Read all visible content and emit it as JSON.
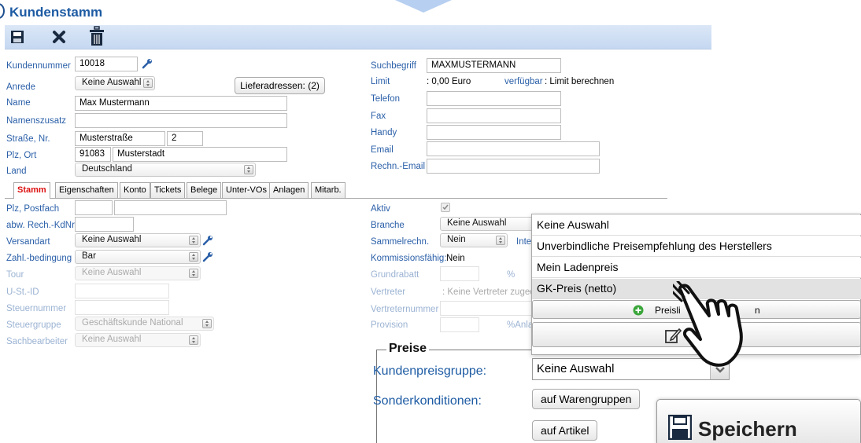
{
  "header": {
    "title": "Kundenstamm"
  },
  "toolbar": {
    "save_icon": "save-icon",
    "close_icon": "close-icon",
    "delete_icon": "trash-icon"
  },
  "left": {
    "kundennummer": {
      "label": "Kundennummer",
      "value": "10018"
    },
    "anrede": {
      "label": "Anrede",
      "value": "Keine Auswahl"
    },
    "lieferadressen_button": "Lieferadressen: (2)",
    "name": {
      "label": "Name",
      "value": "Max Mustermann"
    },
    "namenszusatz": {
      "label": "Namenszusatz",
      "value": ""
    },
    "strasse": {
      "label": "Straße, Nr.",
      "street": "Musterstraße",
      "number": "2"
    },
    "plz_ort": {
      "label": "Plz, Ort",
      "plz": "91083",
      "ort": "Musterstadt"
    },
    "land": {
      "label": "Land",
      "value": "Deutschland"
    }
  },
  "right": {
    "suchbegriff": {
      "label": "Suchbegriff",
      "value": "MAXMUSTERMANN"
    },
    "limit": {
      "label": "Limit",
      "value": ": 0,00 Euro",
      "link": "verfügbar",
      "rest": ": Limit berechnen"
    },
    "telefon": {
      "label": "Telefon",
      "value": ""
    },
    "fax": {
      "label": "Fax",
      "value": ""
    },
    "handy": {
      "label": "Handy",
      "value": ""
    },
    "email": {
      "label": "Email",
      "value": ""
    },
    "rechn_email": {
      "label": "Rechn.-Email",
      "value": ""
    }
  },
  "tabs": [
    "Stamm",
    "Eigenschaften",
    "Konto",
    "Tickets",
    "Belege",
    "Unter-VOs",
    "Anlagen",
    "Mitarb."
  ],
  "stamm_left": {
    "plz_postfach": "Plz, Postfach",
    "abw_rech": "abw. Rech.-KdNr",
    "versandart": {
      "label": "Versandart",
      "value": "Keine Auswahl"
    },
    "zahlbedingung": {
      "label": "Zahl.-bedingung",
      "value": "Bar"
    },
    "tour": {
      "label": "Tour",
      "value": "Keine Auswahl"
    },
    "ust_id": "U-St.-ID",
    "steuernummer": "Steuernummer",
    "steuergruppe": {
      "label": "Steuergruppe",
      "value": "Geschäftskunde National"
    },
    "sachbearbeiter": {
      "label": "Sachbearbeiter",
      "value": "Keine Auswahl"
    }
  },
  "stamm_right": {
    "aktiv": "Aktiv",
    "branche": {
      "label": "Branche",
      "value": "Keine Auswahl"
    },
    "sammelrechn": {
      "label": "Sammelrechn.",
      "value": "Nein",
      "extra": "Inte"
    },
    "kommissionsfaehig": {
      "label": "Kommissionsfähig:",
      "value": "Nein"
    },
    "grundrabatt": {
      "label": "Grundrabatt",
      "unit": "%"
    },
    "vertreter": {
      "label": "Vertreter",
      "value": ": Keine Vertreter zugeo"
    },
    "vertreternummer": "Vertreternummer",
    "provision": {
      "label": "Provision",
      "unit": "%Anla"
    }
  },
  "dropdown": {
    "options": [
      "Keine Auswahl",
      "Unverbindliche Preisempfehlung des Herstellers",
      "Mein Ladenpreis",
      "GK-Preis (netto)"
    ],
    "add_button": "Preisli",
    "add_button_tail": "n"
  },
  "preise": {
    "legend": "Preise",
    "kundenpreisgruppe": {
      "label": "Kundenpreisgruppe:",
      "value": "Keine Auswahl"
    },
    "sonderkonditionen": {
      "label": "Sonderkonditionen:"
    },
    "warengruppen_button": "auf Warengruppen",
    "artikel_button": "auf Artikel",
    "speichern_button": "Speichern"
  }
}
